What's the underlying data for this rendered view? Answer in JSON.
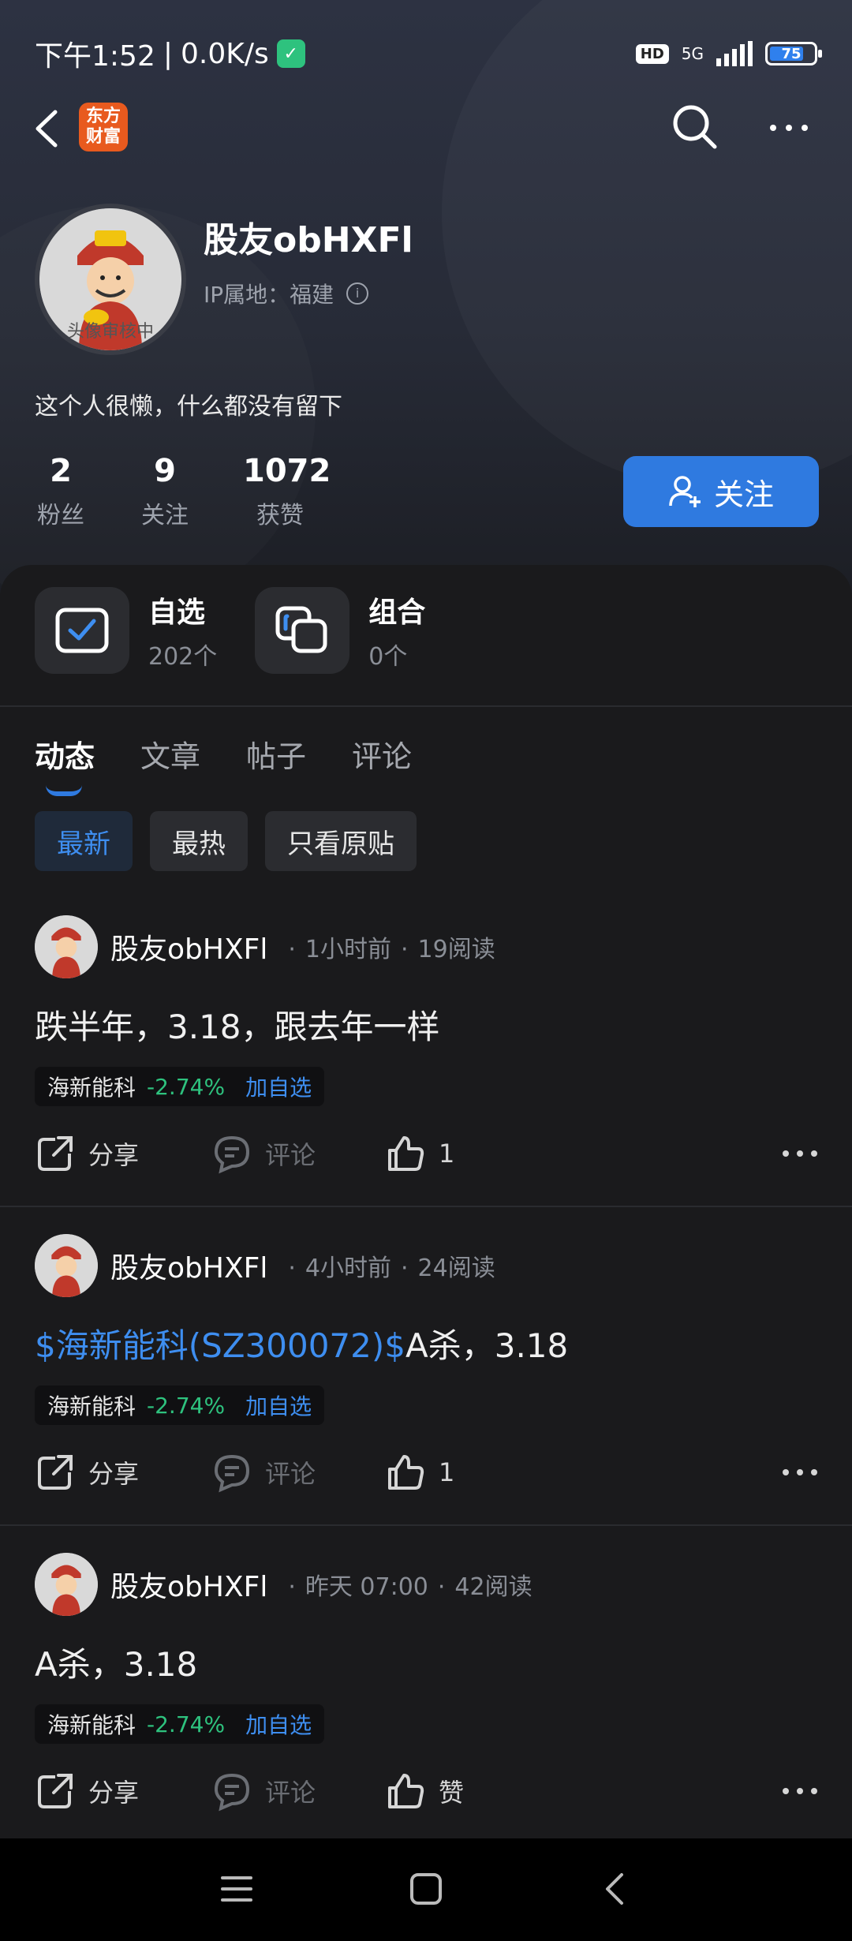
{
  "status_bar": {
    "time": "下午1:52",
    "speed": "0.0K/s",
    "hd": "HD",
    "network": "5G",
    "battery": "75"
  },
  "brand": {
    "logo_line1": "东方",
    "logo_line2": "财富"
  },
  "profile": {
    "username": "股友obHXFl",
    "ip_label": "IP属地：福建",
    "avatar_caption": "头像审核中",
    "bio": "这个人很懒，什么都没有留下",
    "stats": [
      {
        "num": "2",
        "label": "粉丝"
      },
      {
        "num": "9",
        "label": "关注"
      },
      {
        "num": "1072",
        "label": "获赞"
      }
    ],
    "follow_label": "关注"
  },
  "quick_items": [
    {
      "title": "自选",
      "sub": "202个"
    },
    {
      "title": "组合",
      "sub": "0个"
    }
  ],
  "tabs": [
    "动态",
    "文章",
    "帖子",
    "评论"
  ],
  "filters": [
    "最新",
    "最热",
    "只看原贴"
  ],
  "posts": [
    {
      "author": "股友obHXFl",
      "time": "1小时前",
      "reads": "19阅读",
      "link_text": "",
      "content": "跌半年，3.18，跟去年一样",
      "stock": "海新能科",
      "change": "-2.74%",
      "add": "加自选",
      "share": "分享",
      "comment": "评论",
      "like": "1"
    },
    {
      "author": "股友obHXFl",
      "time": "4小时前",
      "reads": "24阅读",
      "link_text": "$海新能科(SZ300072)$",
      "content": "A杀，3.18",
      "stock": "海新能科",
      "change": "-2.74%",
      "add": "加自选",
      "share": "分享",
      "comment": "评论",
      "like": "1"
    },
    {
      "author": "股友obHXFl",
      "time": "昨天 07:00",
      "reads": "42阅读",
      "link_text": "",
      "content": "A杀，3.18",
      "stock": "海新能科",
      "change": "-2.74%",
      "add": "加自选",
      "share": "分享",
      "comment": "评论",
      "like": "赞"
    }
  ],
  "colors": {
    "accent": "#2f7ae0",
    "positive_change": "#2ec27e",
    "brand_logo": "#e85a1e"
  }
}
